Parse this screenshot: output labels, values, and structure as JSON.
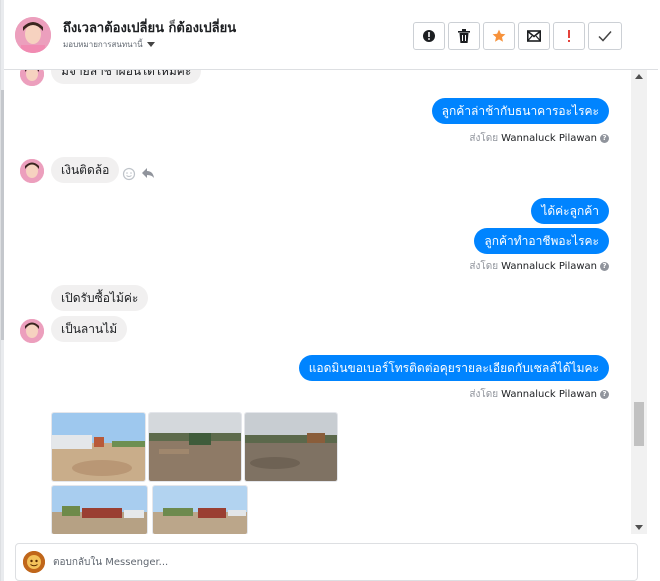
{
  "header": {
    "title": "ถึงเวลาต้องเปลี่ยน ก็ต้องเปลี่ยน",
    "assign_label": "มอบหมายการสนทนานี้",
    "actions": [
      "report-icon",
      "trash-icon",
      "star-icon",
      "mail-icon",
      "exclamation-icon",
      "check-icon"
    ],
    "star_color": "#f7923b",
    "exclamation_color": "#e4433b"
  },
  "messages": {
    "m1": "มีจ่ายล่าช้าผ่อนได้ไหมคะ",
    "m2": "ลูกค้าล่าช้ากับธนาคารอะไรคะ",
    "m3": "เงินติดล้อ",
    "m4": "ได้ค่ะลูกค้า",
    "m5": "ลูกค้าทำอาชีพอะไรคะ",
    "m6": "เปิดรับซื้อไม้ค่ะ",
    "m7": "เป็นลานไม้",
    "m8": "แอดมินขอเบอร์โทรติดต่อคุยรายละเอียดกับเซลล์ได้ไมคะ"
  },
  "sent_by": {
    "prefix": "ส่งโดย",
    "name": "Wannaluck Pilawan"
  },
  "composer": {
    "placeholder": "ตอบกลับใน Messenger..."
  },
  "colors": {
    "outgoing_bubble": "#0084ff",
    "incoming_bubble": "#f1f0f0"
  }
}
